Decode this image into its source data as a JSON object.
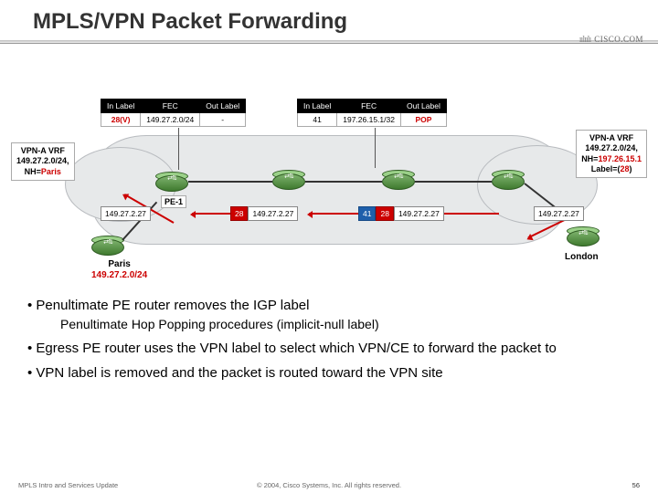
{
  "title": "MPLS/VPN Packet Forwarding",
  "logo_text": "CISCO.COM",
  "table1": {
    "headers": [
      "In Label",
      "FEC",
      "Out Label"
    ],
    "row": {
      "in": "28(V)",
      "fec": "149.27.2.0/24",
      "out": "-"
    }
  },
  "table2": {
    "headers": [
      "In Label",
      "FEC",
      "Out Label"
    ],
    "row": {
      "in": "41",
      "fec": "197.26.15.1/32",
      "out": "POP"
    }
  },
  "vrf_left": {
    "line1": "VPN-A VRF",
    "line2": "149.27.2.0/24,",
    "line3_prefix": "NH=",
    "line3_val": "Paris"
  },
  "vrf_right": {
    "line1": "VPN-A VRF",
    "line2": "149.27.2.0/24,",
    "line3_prefix": "NH=",
    "line3_val": "197.26.15.1",
    "line4_prefix": "Label=(",
    "line4_val": "28",
    "line4_suffix": ")"
  },
  "pe_label": "PE-1",
  "packets": {
    "p1": {
      "ip": "149.27.2.27"
    },
    "p2": {
      "label1": "28",
      "ip": "149.27.2.27"
    },
    "p3": {
      "label1": "41",
      "label2": "28",
      "ip": "149.27.2.27"
    },
    "p4": {
      "ip": "149.27.2.27"
    }
  },
  "site_left": {
    "name": "Paris",
    "subnet": "149.27.2.0/24"
  },
  "site_right": {
    "name": "London"
  },
  "bullets": {
    "b1": "Penultimate PE router removes the IGP label",
    "b1a": "Penultimate Hop Popping procedures (implicit-null label)",
    "b2": "Egress PE router uses the VPN label to select which VPN/CE to forward the packet to",
    "b3": "VPN label is removed and the packet is routed toward the VPN site"
  },
  "footer": {
    "left": "MPLS Intro and Services Update",
    "mid": "© 2004, Cisco Systems, Inc. All rights reserved.",
    "right": "56"
  }
}
